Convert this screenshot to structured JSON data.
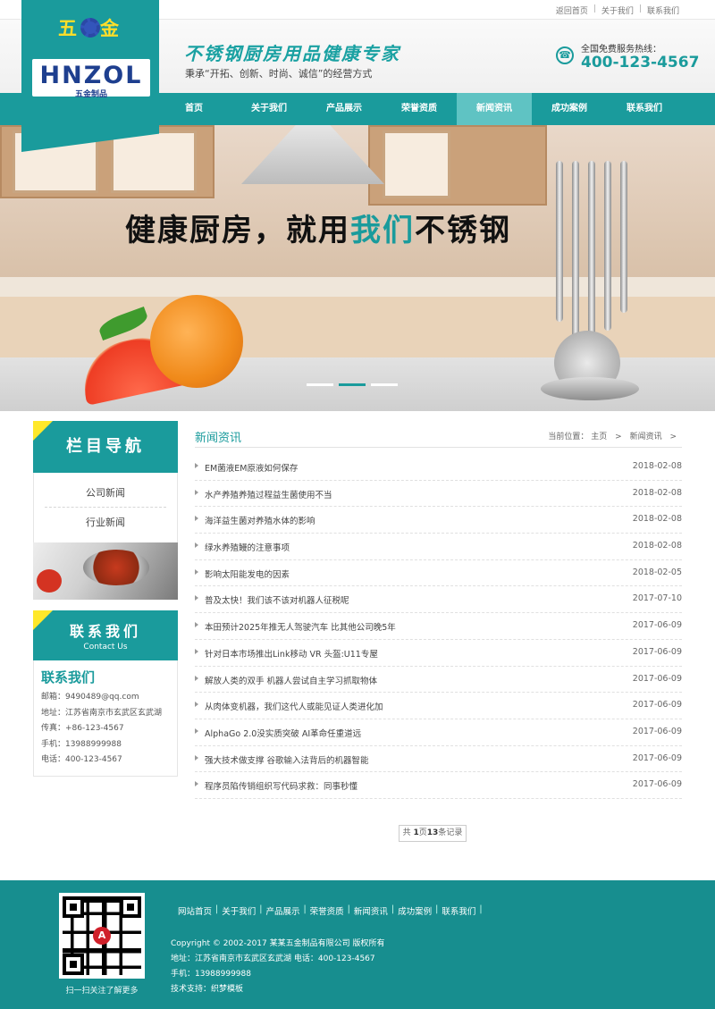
{
  "colors": {
    "accent": "#1a9b9c",
    "nav_active": "#5fc3c3",
    "logo_text": "#ffde2a",
    "footer_bg": "#178e8f"
  },
  "topbar": {
    "links": [
      "返回首页",
      "关于我们",
      "联系我们"
    ]
  },
  "logo": {
    "cn": "五金",
    "en": "HNZOL",
    "sub": "五金制品"
  },
  "header": {
    "slogan": "不锈钢厨房用品健康专家",
    "tagline": "秉承“开拓、创新、时尚、诚信”的经营方式",
    "hotline_label": "全国免费服务热线：",
    "hotline_number": "400-123-4567",
    "hotline_icon": "phone-icon"
  },
  "nav": {
    "items": [
      "首页",
      "关于我们",
      "产品展示",
      "荣誉资质",
      "新闻资讯",
      "成功案例",
      "联系我们"
    ],
    "active": "新闻资讯"
  },
  "banner": {
    "text_before": "健康厨房，就用",
    "text_highlight": "我们",
    "text_after": "不锈钢",
    "slide_count": 3,
    "active_slide": 2
  },
  "sidebar": {
    "column_nav_title": "栏目导航",
    "column_items": [
      "公司新闻",
      "行业新闻"
    ],
    "contact_title": "联系我们",
    "contact_subtitle": "Contact Us",
    "contact_heading": "联系我们",
    "contact_lines": [
      "邮箱：9490489@qq.com",
      "地址：江苏省南京市玄武区玄武湖",
      "传真：+86-123-4567",
      "手机：13988999988",
      "电话：400-123-4567"
    ]
  },
  "main": {
    "title": "新闻资讯",
    "breadcrumb": {
      "label": "当前位置：",
      "items": [
        "主页",
        "新闻资讯"
      ],
      "sep": ">"
    },
    "news": [
      {
        "title": "EM菌液EM原液如何保存",
        "date": "2018-02-08"
      },
      {
        "title": "水产养殖养殖过程益生菌使用不当",
        "date": "2018-02-08"
      },
      {
        "title": "海洋益生菌对养殖水体的影响",
        "date": "2018-02-08"
      },
      {
        "title": "绿水养殖鳗的注意事项",
        "date": "2018-02-08"
      },
      {
        "title": "影响太阳能发电的因素",
        "date": "2018-02-05"
      },
      {
        "title": "普及太快！我们该不该对机器人征税呢",
        "date": "2017-07-10"
      },
      {
        "title": "本田预计2025年推无人驾驶汽车 比其他公司晚5年",
        "date": "2017-06-09"
      },
      {
        "title": "针对日本市场推出Link移动 VR 头盔:U11专屋",
        "date": "2017-06-09"
      },
      {
        "title": "解放人类的双手 机器人尝试自主学习抓取物体",
        "date": "2017-06-09"
      },
      {
        "title": "从肉体变机器，我们这代人或能见证人类进化加",
        "date": "2017-06-09"
      },
      {
        "title": "AlphaGo 2.0没实质突破 AI革命任重道远",
        "date": "2017-06-09"
      },
      {
        "title": "强大技术做支撑 谷歌输入法背后的机器智能",
        "date": "2017-06-09"
      },
      {
        "title": "程序员陷传销组织写代码求救：同事秒懂",
        "date": "2017-06-09"
      }
    ],
    "pager": {
      "prefix": "共 ",
      "pages": "1",
      "mid": "页",
      "records": "13",
      "suffix": "条记录"
    }
  },
  "footer": {
    "nav": [
      "网站首页",
      "关于我们",
      "产品展示",
      "荣誉资质",
      "新闻资讯",
      "成功案例",
      "联系我们"
    ],
    "qr_caption": "扫一扫关注了解更多",
    "copyright": "Copyright © 2002-2017 某某五金制品有限公司 版权所有",
    "address": "地址：江苏省南京市玄武区玄武湖 电话：400-123-4567",
    "mobile": "手机：13988999988",
    "support": "技术支持：织梦模板"
  }
}
